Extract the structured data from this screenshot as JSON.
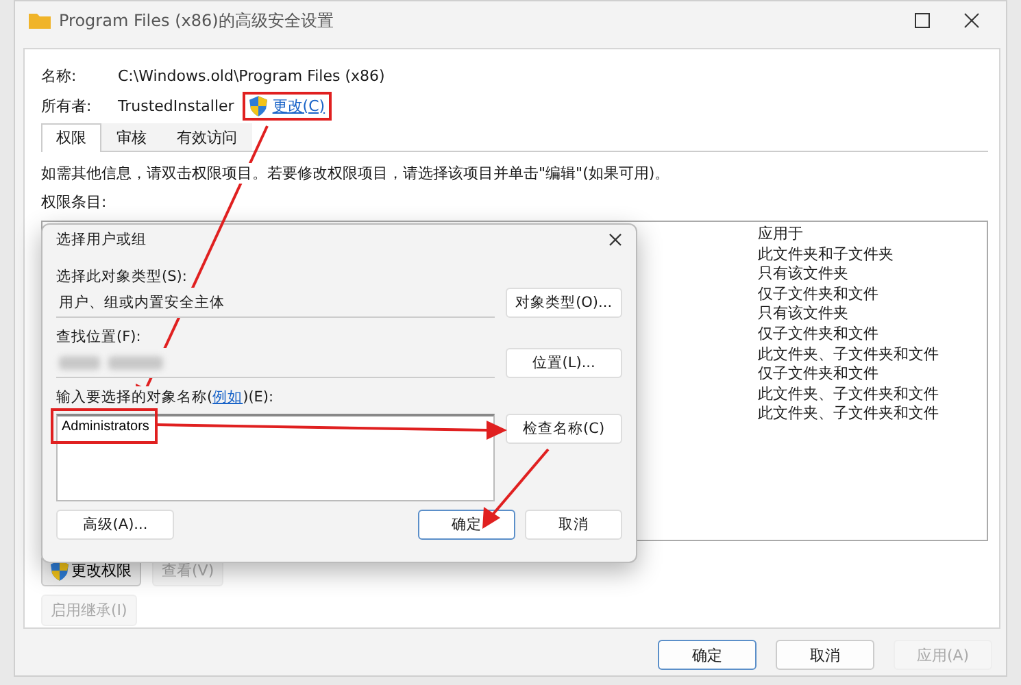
{
  "window": {
    "title": "Program Files (x86)的高级安全设置"
  },
  "info": {
    "name_label": "名称:",
    "name_value": "C:\\Windows.old\\Program Files (x86)",
    "owner_label": "所有者:",
    "owner_value": "TrustedInstaller",
    "change_link": "更改(C)"
  },
  "tabs": [
    {
      "label": "权限",
      "selected": true
    },
    {
      "label": "审核",
      "selected": false
    },
    {
      "label": "有效访问",
      "selected": false
    }
  ],
  "hint": "如需其他信息，请双击权限项目。若要修改权限项目，请选择该项目并单击\"编辑\"(如果可用)。",
  "entries_label": "权限条目:",
  "entries": {
    "header": "应用于",
    "rows": [
      "此文件夹和子文件夹",
      "只有该文件夹",
      "仅子文件夹和文件",
      "只有该文件夹",
      "仅子文件夹和文件",
      "此文件夹、子文件夹和文件",
      "仅子文件夹和文件",
      "此文件夹、子文件夹和文件",
      "此文件夹、子文件夹和文件"
    ]
  },
  "side_buttons": [
    {
      "label": "更改权限",
      "disabled": false,
      "shield": true
    },
    {
      "label": "查看(V)",
      "disabled": true,
      "shield": false
    },
    {
      "label": "启用继承(I)",
      "disabled": true,
      "shield": false
    }
  ],
  "buttons": [
    {
      "label": "确定",
      "disabled": false,
      "default": true
    },
    {
      "label": "取消",
      "disabled": false,
      "default": false
    },
    {
      "label": "应用(A)",
      "disabled": true,
      "default": false
    }
  ],
  "dialog": {
    "title": "选择用户或组",
    "type_label": "选择此对象类型(S):",
    "type_value": "用户、组或内置安全主体",
    "type_button": "对象类型(O)...",
    "location_label": "查找位置(F):",
    "location_button": "位置(L)...",
    "names_label_before": "输入要选择的对象名称(",
    "names_label_link": "例如",
    "names_label_after": ")(E):",
    "names_value": "Administrators",
    "check_button": "检查名称(C)",
    "advanced_button": "高级(A)...",
    "ok_button": "确定",
    "cancel_button": "取消"
  }
}
